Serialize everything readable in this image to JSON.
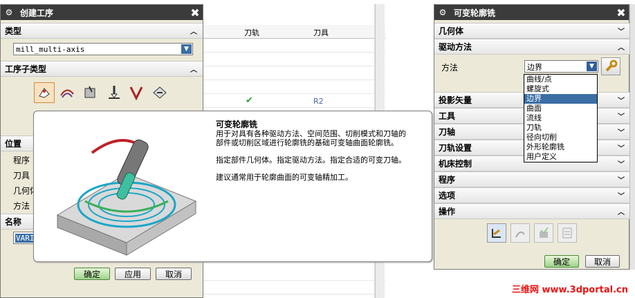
{
  "left_dialog": {
    "title": "创建工序",
    "type_section": "类型",
    "type_value": "mill_multi-axis",
    "subtype_section": "工序子类型",
    "location_section": "位置",
    "location_labels": [
      "程序",
      "刀具",
      "几何体",
      "方法"
    ],
    "name_section": "名称",
    "name_value": "VARI",
    "buttons": {
      "ok": "确定",
      "apply": "应用",
      "cancel": "取消"
    }
  },
  "middle_table": {
    "columns": [
      "刀轨",
      "刀具"
    ],
    "row_tool": "R2",
    "row_tool_2": "R2"
  },
  "tooltip": {
    "title": "可变轮廓铣",
    "para1_line1": "用于对具有各种驱动方法、空间范围、切削模式和刀轴的",
    "para1_line2": "部件或切削区域进行轮廓铣的基础可变轴曲面轮廓铣。",
    "para2": "指定部件几何体。指定驱动方法。指定合适的可变刀轴。",
    "para3": "建议通常用于轮廓曲面的可变轴精加工。"
  },
  "right_dialog": {
    "title": "可变轮廓铣",
    "sections": {
      "geometry": "几何体",
      "drive_method": "驱动方法",
      "projection": "投影矢量",
      "tool": "工具",
      "tool_axis": "刀轴",
      "path_settings": "刀轨设置",
      "machine_control": "机床控制",
      "program": "程序",
      "options": "选项",
      "operations": "操作"
    },
    "method_label": "方法",
    "method_value": "边界",
    "method_options": [
      "曲线/点",
      "螺旋式",
      "边界",
      "曲面",
      "流线",
      "刀轨",
      "径向切削",
      "外形轮廓铣",
      "用户定义"
    ],
    "buttons": {
      "ok": "确定",
      "cancel": "取消"
    }
  },
  "watermark": "三维网 www.3dportal.cn",
  "colors": {
    "selection": "#3a6ea5",
    "ok_button": "#9ed28a",
    "titlebar": "#3b3b3b",
    "check": "#2aa52a"
  }
}
